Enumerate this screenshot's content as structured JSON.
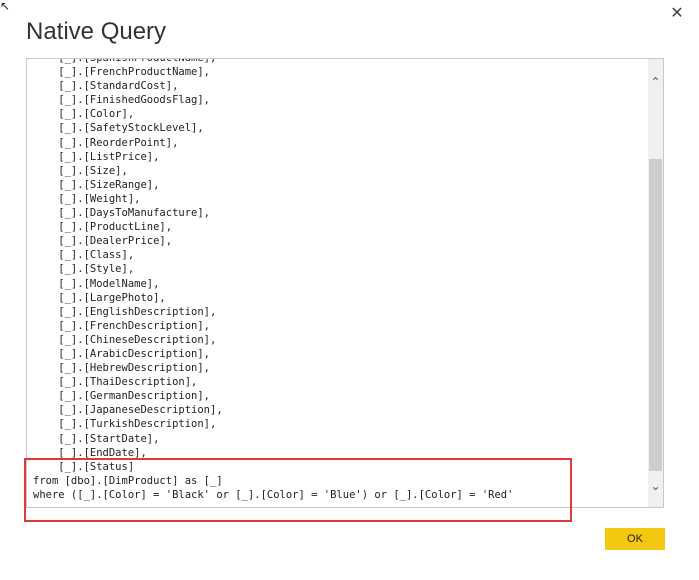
{
  "dialog": {
    "title": "Native Query",
    "close_glyph": "✕",
    "ok_label": "OK",
    "corner_glyph": "↖"
  },
  "query": {
    "lines": [
      "    [_].[SpanishProductName],",
      "    [_].[FrenchProductName],",
      "    [_].[StandardCost],",
      "    [_].[FinishedGoodsFlag],",
      "    [_].[Color],",
      "    [_].[SafetyStockLevel],",
      "    [_].[ReorderPoint],",
      "    [_].[ListPrice],",
      "    [_].[Size],",
      "    [_].[SizeRange],",
      "    [_].[Weight],",
      "    [_].[DaysToManufacture],",
      "    [_].[ProductLine],",
      "    [_].[DealerPrice],",
      "    [_].[Class],",
      "    [_].[Style],",
      "    [_].[ModelName],",
      "    [_].[LargePhoto],",
      "    [_].[EnglishDescription],",
      "    [_].[FrenchDescription],",
      "    [_].[ChineseDescription],",
      "    [_].[ArabicDescription],",
      "    [_].[HebrewDescription],",
      "    [_].[ThaiDescription],",
      "    [_].[GermanDescription],",
      "    [_].[JapaneseDescription],",
      "    [_].[TurkishDescription],",
      "    [_].[StartDate],",
      "    [_].[EndDate],",
      "    [_].[Status]",
      "from [dbo].[DimProduct] as [_]",
      "where ([_].[Color] = 'Black' or [_].[Color] = 'Blue') or [_].[Color] = 'Red'"
    ]
  },
  "scrollbar": {
    "up_glyph": "⌃",
    "down_glyph": "⌄"
  },
  "colors": {
    "highlight": "#e0393a",
    "ok_button": "#f2c811"
  }
}
